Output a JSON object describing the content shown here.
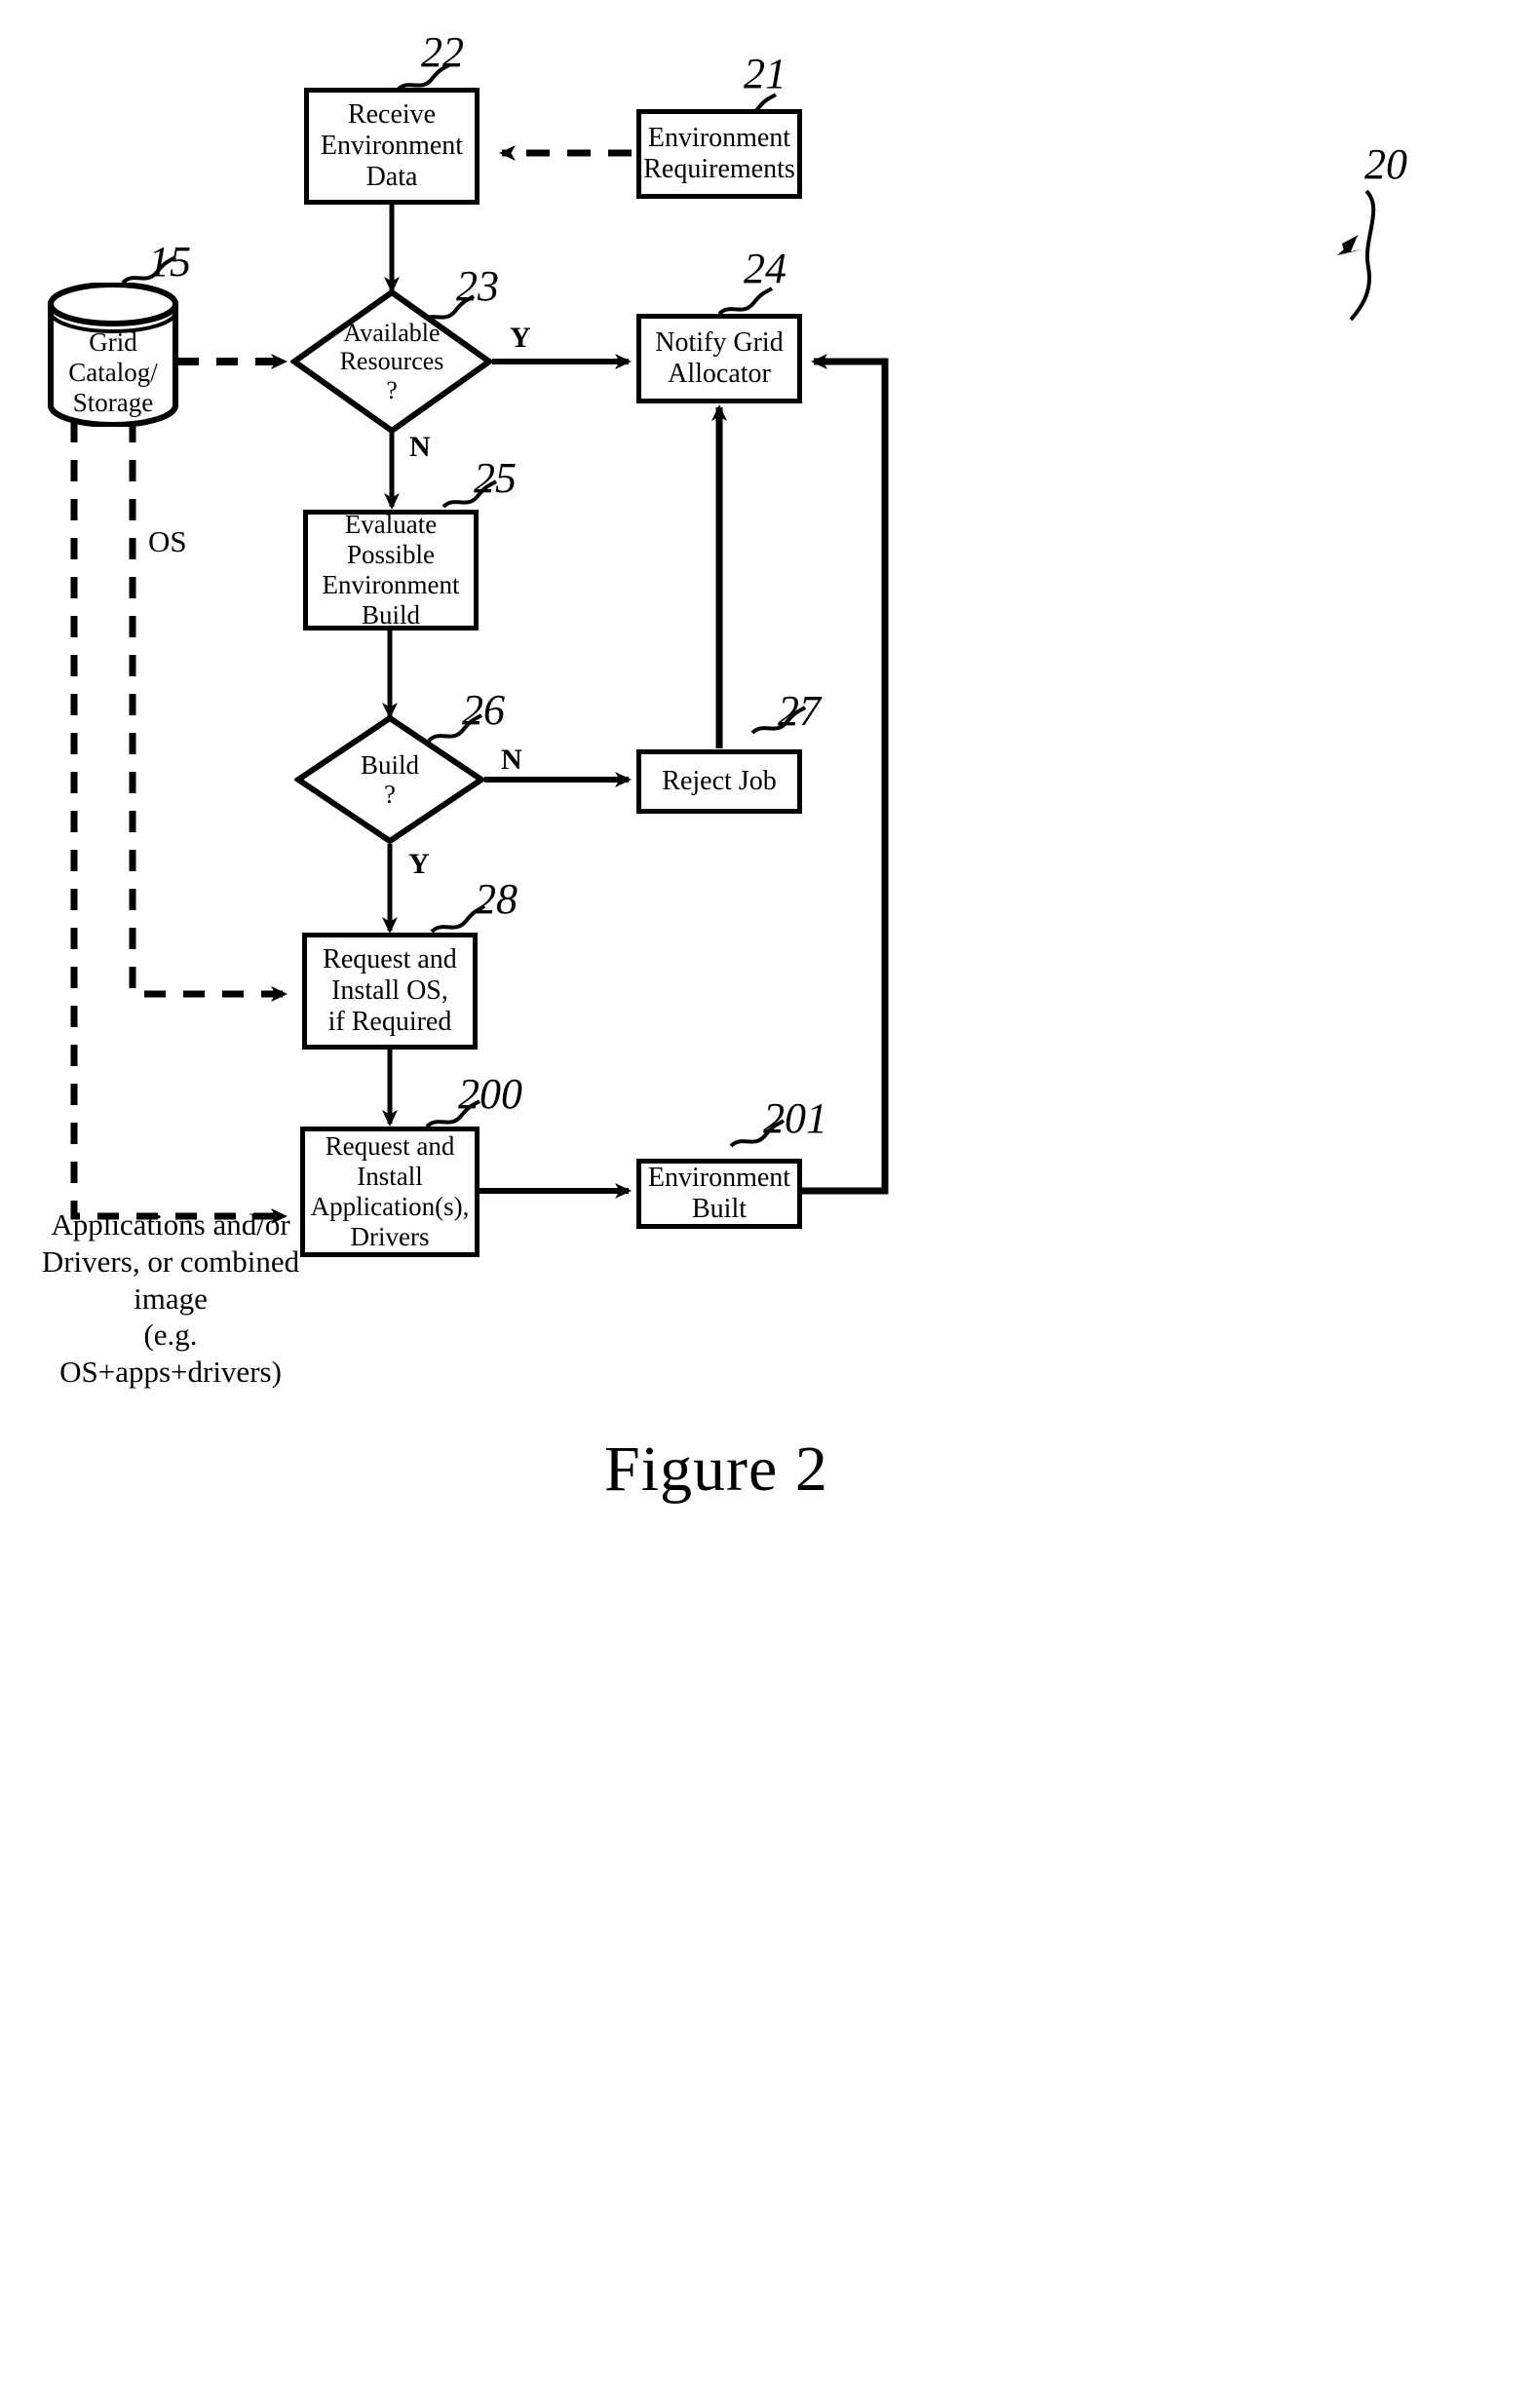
{
  "figure": {
    "caption": "Figure 2",
    "overall_ref": "20"
  },
  "nodes": {
    "environment_requirements": {
      "label": "Environment\nRequirements",
      "ref": "21",
      "shape": "box"
    },
    "receive_environment_data": {
      "label": "Receive\nEnvironment\nData",
      "ref": "22",
      "shape": "box"
    },
    "grid_catalog_storage": {
      "label": "Grid\nCatalog/\nStorage",
      "ref": "15",
      "shape": "cylinder"
    },
    "available_resources": {
      "label": "Available\nResources\n?",
      "ref": "23",
      "shape": "diamond"
    },
    "notify_grid_allocator": {
      "label": "Notify Grid\nAllocator",
      "ref": "24",
      "shape": "box"
    },
    "evaluate_possible_environment_build": {
      "label": "Evaluate\nPossible\nEnvironment\nBuild",
      "ref": "25",
      "shape": "box"
    },
    "build_decision": {
      "label": "Build\n?",
      "ref": "26",
      "shape": "diamond"
    },
    "reject_job": {
      "label": "Reject Job",
      "ref": "27",
      "shape": "box"
    },
    "request_install_os": {
      "label": "Request and\nInstall OS,\nif Required",
      "ref": "28",
      "shape": "box"
    },
    "request_install_applications": {
      "label": "Request and\nInstall\nApplication(s),\nDrivers",
      "ref": "200",
      "shape": "box"
    },
    "environment_built": {
      "label": "Environment\nBuilt",
      "ref": "201",
      "shape": "box"
    }
  },
  "edge_labels": {
    "available_resources_yes": "Y",
    "available_resources_no": "N",
    "build_no": "N",
    "build_yes": "Y"
  },
  "annotations": {
    "os_stream": "OS",
    "apps_stream": "Applications and/or\nDrivers, or combined image\n(e.g. OS+apps+drivers)"
  },
  "colors": {
    "stroke": "#000000",
    "background": "#ffffff"
  }
}
